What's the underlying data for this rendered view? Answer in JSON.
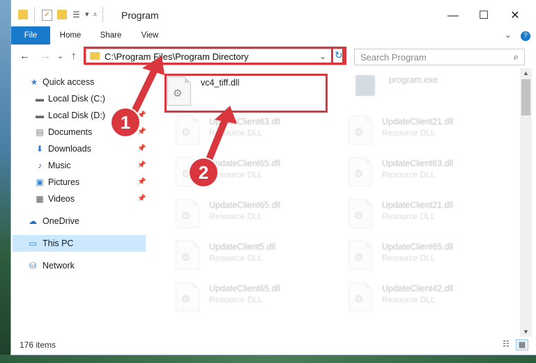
{
  "window": {
    "title": "Program",
    "minimize": "—",
    "maximize": "☐",
    "close": "✕"
  },
  "ribbon": {
    "tabs": [
      "File",
      "Home",
      "Share",
      "View"
    ],
    "expand": "⌄",
    "help": "?"
  },
  "nav": {
    "back": "←",
    "forward": "→",
    "recent": "⌄",
    "up": "↑",
    "address": "C:\\Program Files\\Program Directory",
    "dropdown": "⌄",
    "refresh": "↻",
    "search_placeholder": "Search Program",
    "search_icon": "⌕"
  },
  "sidebar": {
    "items": [
      {
        "label": "Quick access",
        "icon": "star-icon",
        "glyph": "★",
        "color": "#3a83d6",
        "pin": ""
      },
      {
        "label": "Local Disk (C:)",
        "icon": "drive-icon",
        "glyph": "▬",
        "color": "#666",
        "pin": "📌"
      },
      {
        "label": "Local Disk (D:)",
        "icon": "drive-icon",
        "glyph": "▬",
        "color": "#666",
        "pin": "📌"
      },
      {
        "label": "Documents",
        "icon": "documents-icon",
        "glyph": "▤",
        "color": "#777",
        "pin": "📌"
      },
      {
        "label": "Downloads",
        "icon": "downloads-icon",
        "glyph": "⬇",
        "color": "#2b78d0",
        "pin": "📌"
      },
      {
        "label": "Music",
        "icon": "music-icon",
        "glyph": "♪",
        "color": "#2b78d0",
        "pin": "📌"
      },
      {
        "label": "Pictures",
        "icon": "pictures-icon",
        "glyph": "▣",
        "color": "#3a83d6",
        "pin": "📌"
      },
      {
        "label": "Videos",
        "icon": "videos-icon",
        "glyph": "▦",
        "color": "#555",
        "pin": "📌"
      },
      {
        "label": "OneDrive",
        "icon": "onedrive-icon",
        "glyph": "☁",
        "color": "#1c6fc7",
        "pin": ""
      },
      {
        "label": "This PC",
        "icon": "computer-icon",
        "glyph": "▭",
        "color": "#2b78d0",
        "pin": ""
      },
      {
        "label": "Network",
        "icon": "network-icon",
        "glyph": "⛁",
        "color": "#2b78d0",
        "pin": ""
      }
    ]
  },
  "files": {
    "selected": {
      "name": "vc4_tiff.dll"
    },
    "exe": {
      "name": "program.exe"
    },
    "left_column": [
      {
        "name": "UpdateClient63.dll",
        "type": "Resource DLL"
      },
      {
        "name": "UpdateClient65.dll",
        "type": "Resource DLL"
      },
      {
        "name": "UpdateClient65.dll",
        "type": "Resource DLL"
      },
      {
        "name": "UpdateClient5.dll",
        "type": "Resource DLL"
      },
      {
        "name": "UpdateClient65.dll",
        "type": "Resource DLL"
      }
    ],
    "right_column": [
      {
        "name": "UpdateClient21.dll",
        "type": "Resource DLL"
      },
      {
        "name": "UpdateClient63.dll",
        "type": "Resource DLL"
      },
      {
        "name": "UpdateClient21.dll",
        "type": "Resource DLL"
      },
      {
        "name": "UpdateClient65.dll",
        "type": "Resource DLL"
      },
      {
        "name": "UpdateClient42.dll",
        "type": "Resource DLL"
      }
    ]
  },
  "status": {
    "item_count": "176 items"
  },
  "annotations": {
    "step1": "1",
    "step2": "2",
    "color": "#d9363e"
  }
}
